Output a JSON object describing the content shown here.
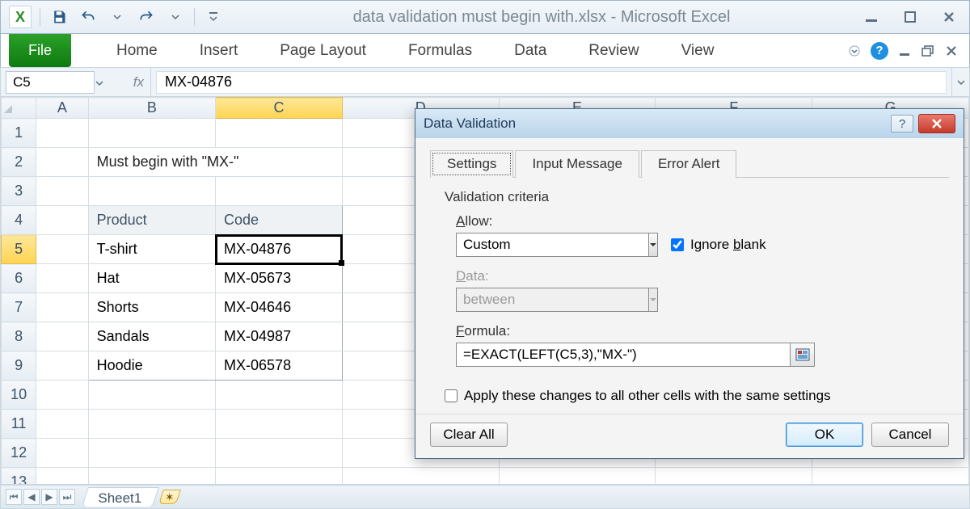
{
  "app": {
    "doc_title": "data validation must begin with.xlsx  -  Microsoft Excel"
  },
  "ribbon": {
    "file": "File",
    "tabs": [
      "Home",
      "Insert",
      "Page Layout",
      "Formulas",
      "Data",
      "Review",
      "View"
    ]
  },
  "formula_bar": {
    "name_box": "C5",
    "fx_label": "fx",
    "value": "MX-04876"
  },
  "grid": {
    "columns": [
      "A",
      "B",
      "C",
      "D",
      "E",
      "F",
      "G"
    ],
    "title": "Must begin with \"MX-\"",
    "headers": {
      "product": "Product",
      "code": "Code"
    },
    "rows": [
      {
        "product": "T-shirt",
        "code": "MX-04876"
      },
      {
        "product": "Hat",
        "code": "MX-05673"
      },
      {
        "product": "Shorts",
        "code": "MX-04646"
      },
      {
        "product": "Sandals",
        "code": "MX-04987"
      },
      {
        "product": "Hoodie",
        "code": "MX-06578"
      }
    ],
    "active_cell": "C5",
    "sheet_name": "Sheet1"
  },
  "dialog": {
    "title": "Data Validation",
    "tabs": {
      "settings": "Settings",
      "input_msg": "Input Message",
      "error": "Error Alert"
    },
    "criteria_label": "Validation criteria",
    "allow_label": "Allow:",
    "allow_value": "Custom",
    "ignore_blank": "Ignore blank",
    "data_label": "Data:",
    "data_value": "between",
    "formula_label": "Formula:",
    "formula_value": "=EXACT(LEFT(C5,3),\"MX-\")",
    "apply_all": "Apply these changes to all other cells with the same settings",
    "buttons": {
      "clear": "Clear All",
      "ok": "OK",
      "cancel": "Cancel"
    }
  }
}
